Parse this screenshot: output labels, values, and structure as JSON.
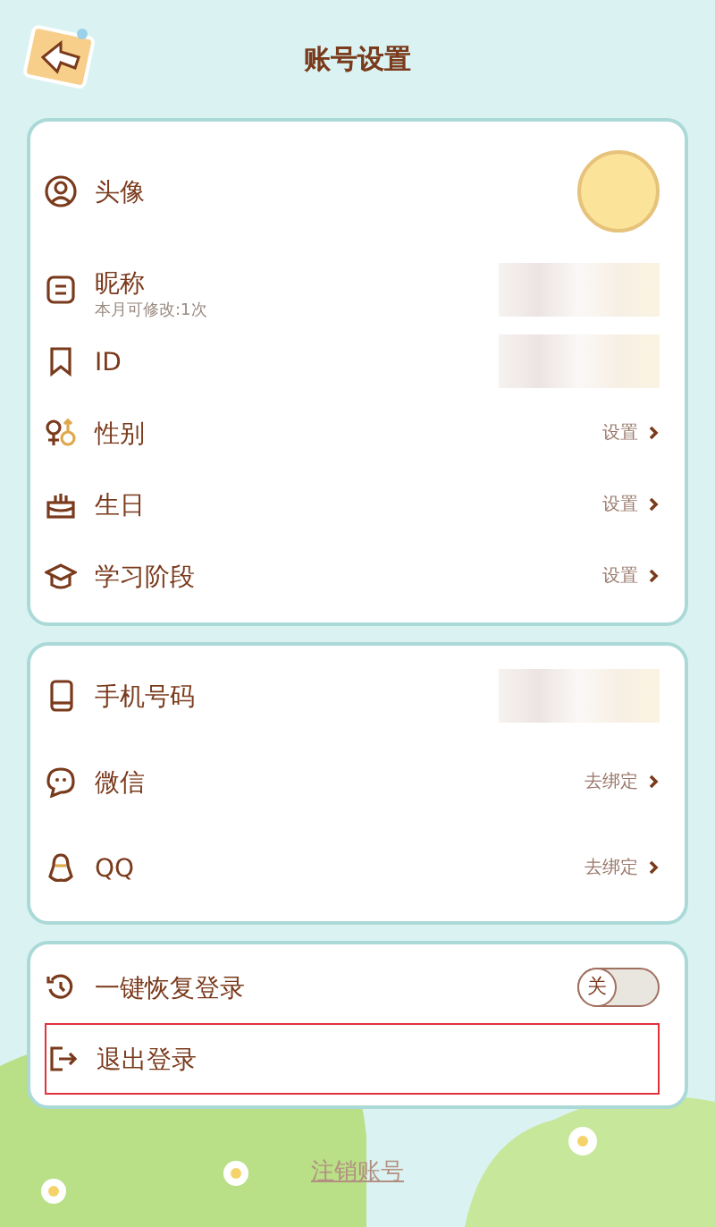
{
  "header": {
    "title": "账号设置"
  },
  "sections": [
    {
      "items": [
        {
          "kind": "avatar",
          "label": "头像"
        },
        {
          "kind": "blurred",
          "label": "昵称",
          "note": "本月可修改:1次"
        },
        {
          "kind": "blurred",
          "label": "ID"
        },
        {
          "kind": "action",
          "label": "性别",
          "action": "设置"
        },
        {
          "kind": "action",
          "label": "生日",
          "action": "设置"
        },
        {
          "kind": "action",
          "label": "学习阶段",
          "action": "设置"
        }
      ]
    },
    {
      "items": [
        {
          "kind": "blurred",
          "label": "手机号码"
        },
        {
          "kind": "action",
          "label": "微信",
          "action": "去绑定"
        },
        {
          "kind": "action",
          "label": "QQ",
          "action": "去绑定"
        }
      ]
    },
    {
      "items": [
        {
          "kind": "toggle",
          "label": "一键恢复登录",
          "on": false,
          "toggle_text": "关"
        },
        {
          "kind": "plain",
          "label": "退出登录",
          "highlighted": true
        }
      ]
    }
  ],
  "footer": {
    "link": "注销账号"
  }
}
